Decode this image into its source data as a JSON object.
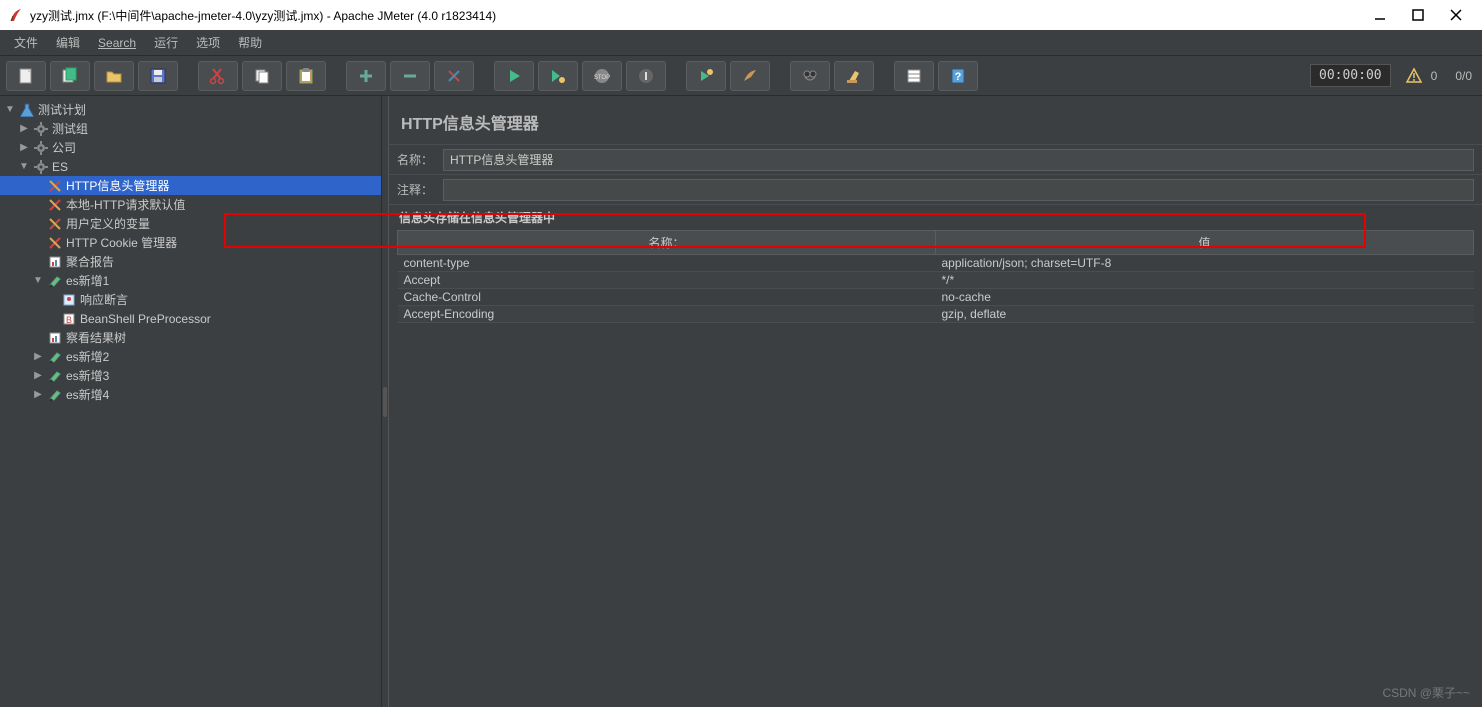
{
  "window": {
    "title": "yzy测试.jmx (F:\\中间件\\apache-jmeter-4.0\\yzy测试.jmx) - Apache JMeter (4.0 r1823414)"
  },
  "menu": {
    "file": "文件",
    "edit": "编辑",
    "search": "Search",
    "run": "运行",
    "options": "选项",
    "help": "帮助"
  },
  "toolbar": {
    "timer": "00:00:00",
    "warn_count": "0",
    "thread_count": "0/0"
  },
  "tree": {
    "root": "测试计划",
    "items": [
      {
        "label": "测试组",
        "indent": 1,
        "icon": "gear",
        "toggle": "▶"
      },
      {
        "label": "公司",
        "indent": 1,
        "icon": "gear",
        "toggle": "▶"
      },
      {
        "label": "ES",
        "indent": 1,
        "icon": "gear",
        "toggle": "▼"
      },
      {
        "label": "HTTP信息头管理器",
        "indent": 2,
        "icon": "wrench",
        "selected": true
      },
      {
        "label": "本地-HTTP请求默认值",
        "indent": 2,
        "icon": "wrench"
      },
      {
        "label": "用户定义的变量",
        "indent": 2,
        "icon": "wrench"
      },
      {
        "label": "HTTP Cookie 管理器",
        "indent": 2,
        "icon": "wrench"
      },
      {
        "label": "聚合报告",
        "indent": 2,
        "icon": "report"
      },
      {
        "label": "es新增1",
        "indent": 2,
        "icon": "sampler",
        "toggle": "▼"
      },
      {
        "label": "响应断言",
        "indent": 3,
        "icon": "assert"
      },
      {
        "label": "BeanShell PreProcessor",
        "indent": 3,
        "icon": "bean"
      },
      {
        "label": "察看结果树",
        "indent": 2,
        "icon": "report"
      },
      {
        "label": "es新增2",
        "indent": 2,
        "icon": "sampler",
        "toggle": "▶"
      },
      {
        "label": "es新增3",
        "indent": 2,
        "icon": "sampler",
        "toggle": "▶"
      },
      {
        "label": "es新增4",
        "indent": 2,
        "icon": "sampler",
        "toggle": "▶"
      }
    ]
  },
  "panel": {
    "title": "HTTP信息头管理器",
    "name_label": "名称：",
    "name_value": "HTTP信息头管理器",
    "comment_label": "注释：",
    "comment_value": "",
    "section": "信息头存储在信息头管理器中",
    "columns": {
      "name": "名称：",
      "value": "值"
    },
    "rows": [
      {
        "name": "content-type",
        "value": "application/json; charset=UTF-8"
      },
      {
        "name": "Accept",
        "value": "*/*"
      },
      {
        "name": "Cache-Control",
        "value": "no-cache"
      },
      {
        "name": "Accept-Encoding",
        "value": "gzip, deflate"
      }
    ]
  },
  "watermark": "CSDN @栗子~~"
}
